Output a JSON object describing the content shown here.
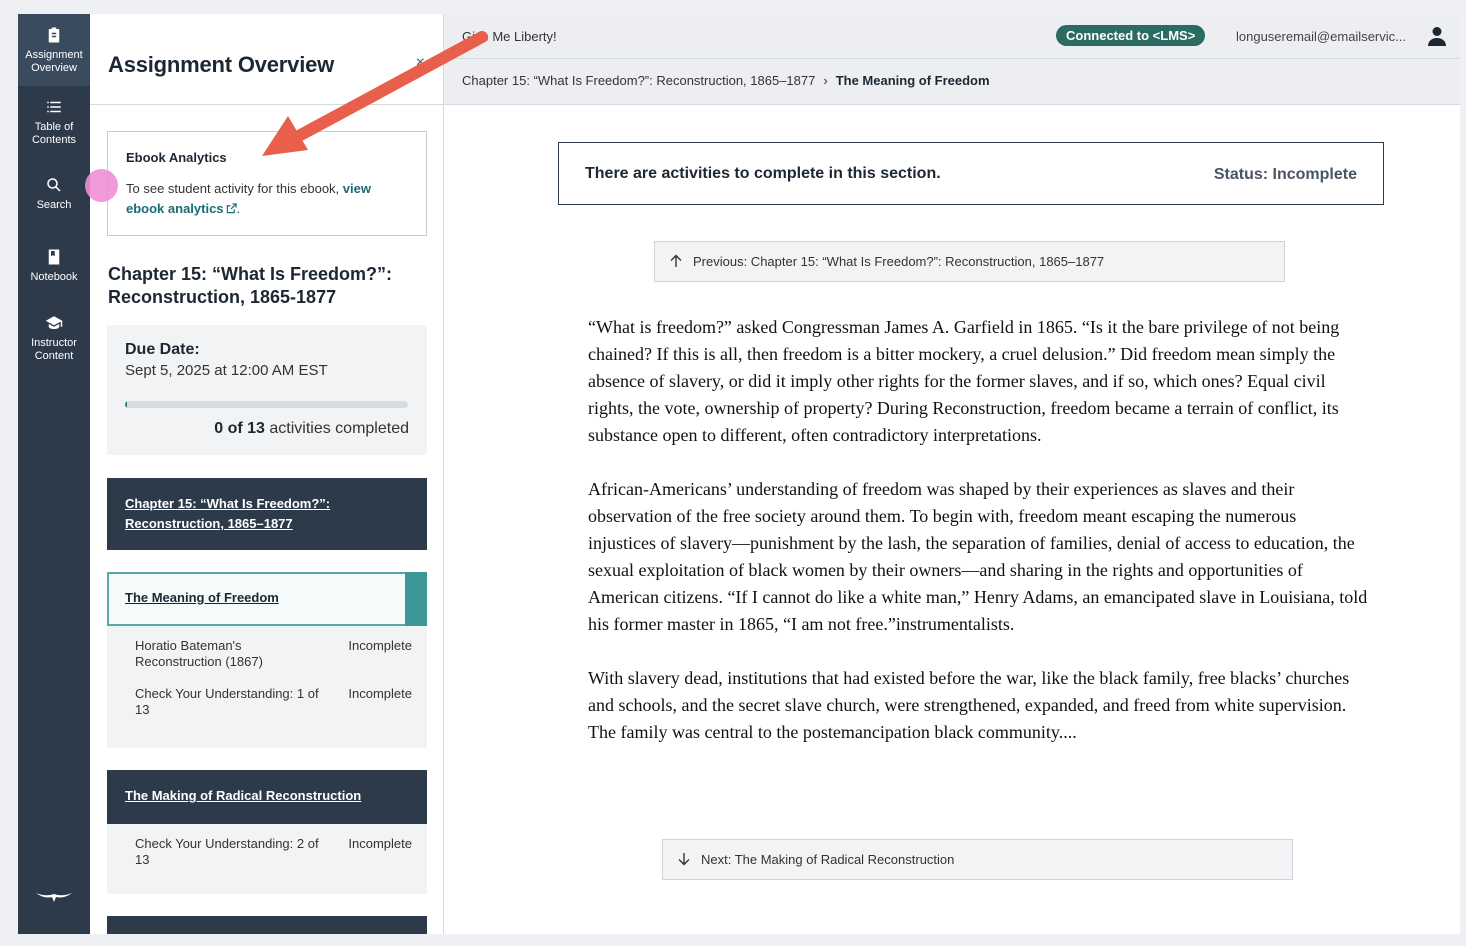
{
  "rail": {
    "items": [
      {
        "label": "Assignment Overview",
        "icon": "clipboard-icon"
      },
      {
        "label": "Table of Contents",
        "icon": "list-icon"
      },
      {
        "label": "Search",
        "icon": "search-icon"
      },
      {
        "label": "Notebook",
        "icon": "notebook-icon"
      },
      {
        "label": "Instructor Content",
        "icon": "graduation-cap-icon"
      }
    ]
  },
  "panel": {
    "title": "Assignment Overview",
    "close": "×",
    "analytics": {
      "title": "Ebook Analytics",
      "text": "To see student activity for this ebook, ",
      "link": "view ebook analytics",
      "period": "."
    },
    "chapter_title": "Chapter 15: “What Is Freedom?”: Reconstruction, 1865-1877",
    "due": {
      "label": "Due Date:",
      "value": "Sept 5, 2025 at 12:00 AM EST",
      "completed": "0 of 13",
      "completed_suffix": " activities completed",
      "progress": 0.0
    },
    "sections": [
      {
        "title": "Chapter 15: “What Is Freedom?”: Reconstruction, 1865–1877"
      },
      {
        "title": "The Meaning of Freedom",
        "activities": [
          {
            "name": "Horatio Bateman's Reconstruction (1867)",
            "status": "Incomplete"
          },
          {
            "name": "Check Your Understanding: 1 of 13",
            "status": "Incomplete"
          }
        ]
      },
      {
        "title": "The Making of Radical Reconstruction",
        "activities": [
          {
            "name": "Check Your Understanding: 2 of 13",
            "status": "Incomplete"
          }
        ]
      }
    ]
  },
  "topbar": {
    "book_title": "Give Me Liberty!",
    "lms": "Connected to <LMS>",
    "email": "longuseremail@emailservic..."
  },
  "breadcrumb": {
    "chapter": "Chapter 15: “What Is Freedom?”: Reconstruction, 1865–1877",
    "separator": "›",
    "current": "The Meaning of Freedom"
  },
  "status_box": {
    "message": "There are activities to complete in this section.",
    "status": "Status: Incomplete"
  },
  "nav": {
    "previous": "Previous: Chapter 15: “What Is Freedom?”: Reconstruction, 1865–1877",
    "next": "Next: The Making of Radical Reconstruction"
  },
  "reading": {
    "paragraphs": [
      "“What is freedom?” asked Congressman James A. Garfield in 1865. “Is it the bare privilege of not being chained? If this is all, then freedom is a bitter mockery, a cruel delusion.” Did freedom mean simply the absence of slavery, or did it imply other rights for the former slaves, and if so, which ones? Equal civil rights, the vote, ownership of property? During Reconstruction, freedom became a terrain of conflict, its substance open to different, often contradictory interpretations.",
      "African-Americans’ understanding of freedom was shaped by their experiences as slaves and their observation of the free society around them. To begin with, freedom meant escaping the numerous injustices of slavery—punishment by the lash, the separation of families, denial of access to education, the sexual exploitation of black women by their owners—and sharing in the rights and opportunities of American citizens. “If I cannot do like a white man,” Henry Adams, an emancipated slave in Louisiana, told his former master in 1865, “I am not free.”instrumentalists.",
      "With slavery dead, institutions that had existed before the war, like the black family, free blacks’ churches and schools, and the secret slave church, were strengthened, expanded, and freed from white supervision. The family was central to the postemancipation black community...."
    ]
  },
  "colors": {
    "rail": "#2d3a4a",
    "accent": "#2e7d7d",
    "lms_badge": "#2c6b63",
    "annotation_arrow": "#e8604c",
    "annotation_dot": "#ef8fd6"
  }
}
